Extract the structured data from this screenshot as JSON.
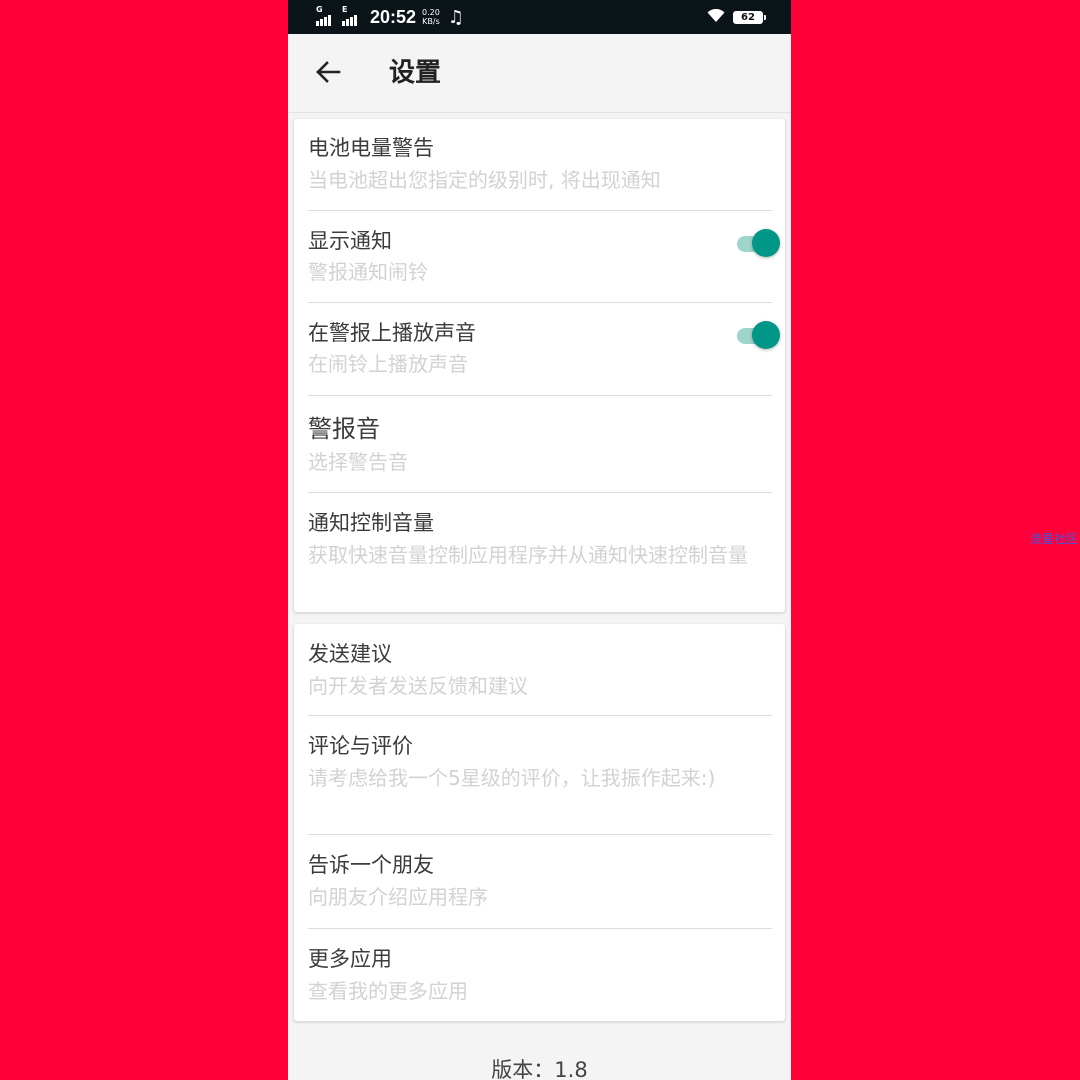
{
  "status_bar": {
    "sim1_type": "G",
    "sim2_type": "E",
    "time": "20:52",
    "speed_value": "0.20",
    "speed_unit": "KB/s",
    "music_glyph": "♫",
    "battery": "62",
    "icons": [
      "signal-icon",
      "wifi-icon",
      "battery-icon",
      "music-note-icon"
    ]
  },
  "app_bar": {
    "title": "设置",
    "back_icon": "arrow-left-icon"
  },
  "settings_group_1": {
    "items": [
      {
        "title": "电池电量警告",
        "subtitle": "当电池超出您指定的级别时, 将出现通知"
      },
      {
        "title": "显示通知",
        "subtitle": "警报通知闹铃",
        "toggle_on": true
      },
      {
        "title": "在警报上播放声音",
        "subtitle": "在闹铃上播放声音",
        "toggle_on": true
      },
      {
        "title": "警报音",
        "subtitle": "选择警告音"
      },
      {
        "title": "通知控制音量",
        "subtitle": "获取快速音量控制应用程序并从通知快速控制音量"
      }
    ]
  },
  "settings_group_2": {
    "items": [
      {
        "title": "发送建议",
        "subtitle": "向开发者发送反馈和建议"
      },
      {
        "title": "评论与评价",
        "subtitle": "请考虑给我一个5星级的评价，让我振作起来:)"
      },
      {
        "title": "告诉一个朋友",
        "subtitle": "向朋友介绍应用程序"
      },
      {
        "title": "更多应用",
        "subtitle": "查看我的更多应用"
      }
    ]
  },
  "footer": {
    "version": "版本：1.8"
  },
  "watermark": "流星社区",
  "colors": {
    "background": "#ff0038",
    "status_bar": "#0b1419",
    "accent": "#009688",
    "accent_track": "#9ed6cb",
    "title_text": "#3c3c3c",
    "subtitle_text": "#d2d2d2"
  }
}
